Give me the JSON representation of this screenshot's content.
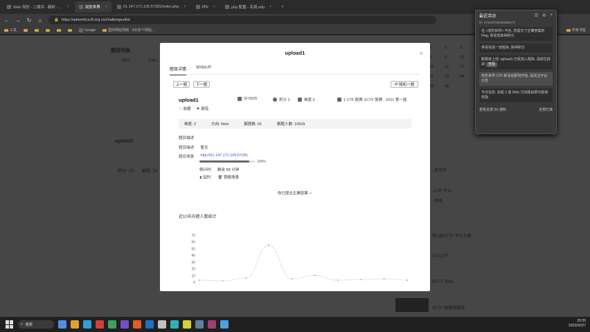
{
  "browser": {
    "tabs": [
      {
        "label": "Web 攻防 - 二周目 - 解析 - ...",
        "active": false
      },
      {
        "label": "攻防世界",
        "active": true
      },
      {
        "label": "61.147.171.105:57281/index.php",
        "active": false
      },
      {
        "label": "php",
        "active": false
      },
      {
        "label": "php 配置 - 实用 php",
        "active": false
      }
    ],
    "url": "https://adworld.xctf.org.cn/challenges/list",
    "bookmarks": [
      "",
      "工具",
      "",
      "",
      "",
      "",
      "",
      "",
      "",
      "",
      "",
      "",
      "Google",
      "国外网站导航 - 200多个网站 ..."
    ],
    "other_bookmarks": "所有书签"
  },
  "background": {
    "heading": "题目列表",
    "tabs": [
      "Misc",
      "Pwn"
    ],
    "card_title": "upload1",
    "calendar": [
      "1",
      "2",
      "3",
      "4",
      "8",
      "9",
      "10",
      "11",
      "15",
      "16",
      "17",
      "18",
      "22",
      "23",
      "24",
      "25",
      "29",
      "30",
      "",
      ""
    ],
    "right_text": [
      "...提交并",
      "...CTF 平台",
      "...获取",
      "第1届XCTF 平台大赛"
    ],
    "news": [
      "CATCTF",
      "RCTF 2021",
      "XCTF 联赛预赛会"
    ],
    "score_row": [
      "积分: 3分",
      "解题: 10"
    ]
  },
  "side_panel": {
    "title": "最近活动",
    "id": "ID: 279418796492956471",
    "items": [
      "在 <攻防世界> 平台, 您提交了正确答案的Flag, 恭喜您获得积分",
      "恭喜完成一道题目, 获得积分",
      "新题目上线: upload1 已经加入题库, 请前往挑战",
      "攻防世界 CTF 新活动即将开始, 请关注平台公告",
      "今日任务: 完成 3 道 Web 方向题目即可获得奖励"
    ],
    "button": "查看",
    "footer_left": "查看全部 (5) 通知",
    "footer_right": "全部已读"
  },
  "modal": {
    "title": "upload1",
    "tabs": [
      "题目详情",
      "WriteUP"
    ],
    "prev": "上一题",
    "next": "下一题",
    "random": "随机一题",
    "challenge_name": "upload1",
    "id": "ID:5505",
    "points": "积分 2",
    "difficulty": "难度:3",
    "source": "1 CTF 联赛 XCTF 联赛 - 2021 第一届",
    "favorite": "收藏",
    "report": "报错",
    "stats": [
      "难度: 2",
      "方向: Web",
      "解题数: 01",
      "解题人数: 10509"
    ],
    "desc_title": "题目描述",
    "desc_label": "题目描述:",
    "desc_value": "暂无",
    "env_label": "题目场景:",
    "env_url": "http://61.147.171.105:57281",
    "progress_pct": 0.9,
    "progress_text": "100%",
    "countdown_label": "倒计时:",
    "countdown_value": "剩余 58 分钟",
    "delay": "延时",
    "destroy": "销毁场景",
    "submitted": "你已提交正确答案 ✓",
    "chart_title": "近10天内题人数统计",
    "chart_yticks": [
      "70",
      "60",
      "50",
      "40",
      "30",
      "20",
      "10",
      "0"
    ]
  },
  "chart_data": {
    "type": "line",
    "title": "近10天内题人数统计",
    "y_ticks": [
      0,
      10,
      20,
      30,
      40,
      50,
      60,
      70
    ],
    "ylim": [
      0,
      70
    ],
    "values": [
      3,
      2,
      6,
      55,
      5,
      10,
      3,
      4,
      5,
      3
    ]
  },
  "taskbar": {
    "search": "搜索",
    "time": "20:35",
    "date": "2023/10/27"
  }
}
